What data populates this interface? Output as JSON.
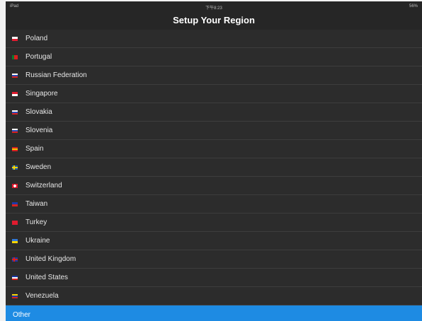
{
  "status_bar": {
    "device": "iPad",
    "time": "下午8:23",
    "battery": "56%"
  },
  "nav": {
    "title": "Setup Your Region"
  },
  "regions": [
    {
      "label": "Poland",
      "flag": [
        "#ffffff",
        "#e01b2f"
      ]
    },
    {
      "label": "Portugal",
      "flag": [
        "#0c7a2d",
        "#d8201f"
      ],
      "vertical": true
    },
    {
      "label": "Russian Federation",
      "flag": [
        "#ffffff",
        "#2a49b6",
        "#d8201f"
      ]
    },
    {
      "label": "Singapore",
      "flag": [
        "#e01b2f",
        "#ffffff"
      ]
    },
    {
      "label": "Slovakia",
      "flag": [
        "#ffffff",
        "#2a49b6",
        "#d8201f"
      ]
    },
    {
      "label": "Slovenia",
      "flag": [
        "#ffffff",
        "#2a49b6",
        "#d8201f"
      ]
    },
    {
      "label": "Spain",
      "flag": [
        "#d8201f",
        "#f5c400",
        "#d8201f"
      ]
    },
    {
      "label": "Sweden",
      "flag": [
        "#1f5fa8",
        "#f5d300"
      ],
      "cross": true
    },
    {
      "label": "Switzerland",
      "flag": [
        "#e01b2f"
      ],
      "swiss": true
    },
    {
      "label": "Taiwan",
      "flag": [
        "#1d3aa8",
        "#d8201f"
      ]
    },
    {
      "label": "Turkey",
      "flag": [
        "#e01b2f"
      ]
    },
    {
      "label": "Ukraine",
      "flag": [
        "#2f78d8",
        "#f5d300"
      ]
    },
    {
      "label": "United Kingdom",
      "flag": [
        "#1d3aa8",
        "#d8201f"
      ],
      "cross": true
    },
    {
      "label": "United States",
      "flag": [
        "#1d3aa8",
        "#ffffff",
        "#d8201f"
      ]
    },
    {
      "label": "Venezuela",
      "flag": [
        "#f5d300",
        "#1d3aa8",
        "#d8201f"
      ]
    }
  ],
  "other": {
    "label": "Other"
  },
  "colors": {
    "background": "#262626",
    "row": "#2c2c2c",
    "selected": "#1e8be3"
  }
}
